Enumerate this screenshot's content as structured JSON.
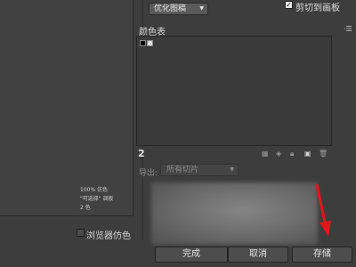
{
  "optimize": {
    "algorithm_value": "优化图稿",
    "clip_label": "剪切到画板",
    "clip_checked": true
  },
  "color_table": {
    "title": "颜色表",
    "count": "2",
    "swatches": [
      "black",
      "transparent"
    ],
    "menu_icon": "panel-menu-icon"
  },
  "export": {
    "label": "导出:",
    "value": "所有切片"
  },
  "preview_info": {
    "line1": "100% 仿色",
    "line2": "\"可选择\" 调板",
    "line3": "2 色"
  },
  "browser_dither": {
    "label": "浏览器仿色",
    "checked": false
  },
  "buttons": {
    "done": "完成",
    "cancel": "取消",
    "save": "存储"
  },
  "colors": {
    "background": "#3d3d3d",
    "arrow": "#e8141b"
  }
}
